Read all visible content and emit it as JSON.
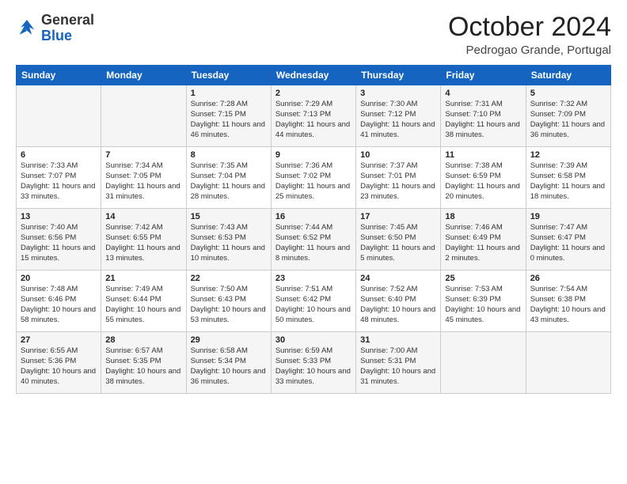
{
  "logo": {
    "general": "General",
    "blue": "Blue"
  },
  "header": {
    "month": "October 2024",
    "location": "Pedrogao Grande, Portugal"
  },
  "columns": [
    "Sunday",
    "Monday",
    "Tuesday",
    "Wednesday",
    "Thursday",
    "Friday",
    "Saturday"
  ],
  "weeks": [
    [
      {
        "day": "",
        "text": ""
      },
      {
        "day": "",
        "text": ""
      },
      {
        "day": "1",
        "text": "Sunrise: 7:28 AM\nSunset: 7:15 PM\nDaylight: 11 hours and 46 minutes."
      },
      {
        "day": "2",
        "text": "Sunrise: 7:29 AM\nSunset: 7:13 PM\nDaylight: 11 hours and 44 minutes."
      },
      {
        "day": "3",
        "text": "Sunrise: 7:30 AM\nSunset: 7:12 PM\nDaylight: 11 hours and 41 minutes."
      },
      {
        "day": "4",
        "text": "Sunrise: 7:31 AM\nSunset: 7:10 PM\nDaylight: 11 hours and 38 minutes."
      },
      {
        "day": "5",
        "text": "Sunrise: 7:32 AM\nSunset: 7:09 PM\nDaylight: 11 hours and 36 minutes."
      }
    ],
    [
      {
        "day": "6",
        "text": "Sunrise: 7:33 AM\nSunset: 7:07 PM\nDaylight: 11 hours and 33 minutes."
      },
      {
        "day": "7",
        "text": "Sunrise: 7:34 AM\nSunset: 7:05 PM\nDaylight: 11 hours and 31 minutes."
      },
      {
        "day": "8",
        "text": "Sunrise: 7:35 AM\nSunset: 7:04 PM\nDaylight: 11 hours and 28 minutes."
      },
      {
        "day": "9",
        "text": "Sunrise: 7:36 AM\nSunset: 7:02 PM\nDaylight: 11 hours and 25 minutes."
      },
      {
        "day": "10",
        "text": "Sunrise: 7:37 AM\nSunset: 7:01 PM\nDaylight: 11 hours and 23 minutes."
      },
      {
        "day": "11",
        "text": "Sunrise: 7:38 AM\nSunset: 6:59 PM\nDaylight: 11 hours and 20 minutes."
      },
      {
        "day": "12",
        "text": "Sunrise: 7:39 AM\nSunset: 6:58 PM\nDaylight: 11 hours and 18 minutes."
      }
    ],
    [
      {
        "day": "13",
        "text": "Sunrise: 7:40 AM\nSunset: 6:56 PM\nDaylight: 11 hours and 15 minutes."
      },
      {
        "day": "14",
        "text": "Sunrise: 7:42 AM\nSunset: 6:55 PM\nDaylight: 11 hours and 13 minutes."
      },
      {
        "day": "15",
        "text": "Sunrise: 7:43 AM\nSunset: 6:53 PM\nDaylight: 11 hours and 10 minutes."
      },
      {
        "day": "16",
        "text": "Sunrise: 7:44 AM\nSunset: 6:52 PM\nDaylight: 11 hours and 8 minutes."
      },
      {
        "day": "17",
        "text": "Sunrise: 7:45 AM\nSunset: 6:50 PM\nDaylight: 11 hours and 5 minutes."
      },
      {
        "day": "18",
        "text": "Sunrise: 7:46 AM\nSunset: 6:49 PM\nDaylight: 11 hours and 2 minutes."
      },
      {
        "day": "19",
        "text": "Sunrise: 7:47 AM\nSunset: 6:47 PM\nDaylight: 11 hours and 0 minutes."
      }
    ],
    [
      {
        "day": "20",
        "text": "Sunrise: 7:48 AM\nSunset: 6:46 PM\nDaylight: 10 hours and 58 minutes."
      },
      {
        "day": "21",
        "text": "Sunrise: 7:49 AM\nSunset: 6:44 PM\nDaylight: 10 hours and 55 minutes."
      },
      {
        "day": "22",
        "text": "Sunrise: 7:50 AM\nSunset: 6:43 PM\nDaylight: 10 hours and 53 minutes."
      },
      {
        "day": "23",
        "text": "Sunrise: 7:51 AM\nSunset: 6:42 PM\nDaylight: 10 hours and 50 minutes."
      },
      {
        "day": "24",
        "text": "Sunrise: 7:52 AM\nSunset: 6:40 PM\nDaylight: 10 hours and 48 minutes."
      },
      {
        "day": "25",
        "text": "Sunrise: 7:53 AM\nSunset: 6:39 PM\nDaylight: 10 hours and 45 minutes."
      },
      {
        "day": "26",
        "text": "Sunrise: 7:54 AM\nSunset: 6:38 PM\nDaylight: 10 hours and 43 minutes."
      }
    ],
    [
      {
        "day": "27",
        "text": "Sunrise: 6:55 AM\nSunset: 5:36 PM\nDaylight: 10 hours and 40 minutes."
      },
      {
        "day": "28",
        "text": "Sunrise: 6:57 AM\nSunset: 5:35 PM\nDaylight: 10 hours and 38 minutes."
      },
      {
        "day": "29",
        "text": "Sunrise: 6:58 AM\nSunset: 5:34 PM\nDaylight: 10 hours and 36 minutes."
      },
      {
        "day": "30",
        "text": "Sunrise: 6:59 AM\nSunset: 5:33 PM\nDaylight: 10 hours and 33 minutes."
      },
      {
        "day": "31",
        "text": "Sunrise: 7:00 AM\nSunset: 5:31 PM\nDaylight: 10 hours and 31 minutes."
      },
      {
        "day": "",
        "text": ""
      },
      {
        "day": "",
        "text": ""
      }
    ]
  ]
}
